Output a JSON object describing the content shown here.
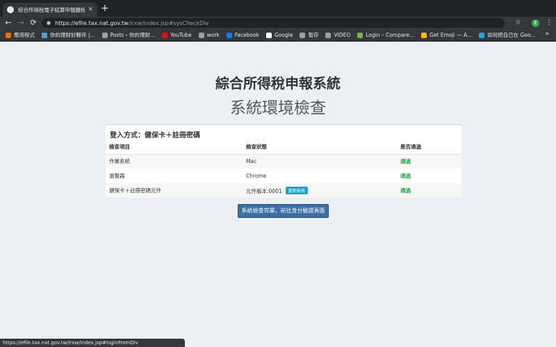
{
  "browser": {
    "tab": {
      "title": "綜合所得稅電子結算申報繳稅系統",
      "favicon": "globe-icon",
      "close_label": "✕"
    },
    "new_tab_label": "+",
    "nav": {
      "back": "←",
      "forward": "→",
      "reload": "⟳"
    },
    "lock": "🔒",
    "url_host": "https://efile.tax.nat.gov.tw",
    "url_path": "/irxw/index.jsp#sysCheckDiv",
    "star": "☆",
    "profile_initial": "E",
    "menu": "⋮",
    "bookmarks": [
      {
        "label": "應用程式",
        "icon": "apps-grid-icon",
        "color": "#e8710a"
      },
      {
        "label": "你的理財好夥伴 |...",
        "icon": "finance-icon",
        "color": "#4fa3d1"
      },
      {
        "label": "Posts ‹ 你的理財...",
        "icon": "page-icon",
        "color": "#9aa0a6"
      },
      {
        "label": "YouTube",
        "icon": "youtube-icon",
        "color": "#ff0000"
      },
      {
        "label": "work",
        "icon": "folder-icon",
        "color": "#9aa0a6"
      },
      {
        "label": "Facebook",
        "icon": "facebook-icon",
        "color": "#1877f2"
      },
      {
        "label": "Google",
        "icon": "google-icon",
        "color": "#ffffff"
      },
      {
        "label": "暫存",
        "icon": "folder-icon",
        "color": "#9aa0a6"
      },
      {
        "label": "VIDEO",
        "icon": "folder-icon",
        "color": "#9aa0a6"
      },
      {
        "label": "Login – Compare...",
        "icon": "login-icon",
        "color": "#7cb342"
      },
      {
        "label": "Get Emoji — A...",
        "icon": "emoji-icon",
        "color": "#fbbc04"
      },
      {
        "label": "如何把自己在 Goo...",
        "icon": "telegram-icon",
        "color": "#2aa3e6"
      }
    ],
    "bookmarks_more": "»"
  },
  "page": {
    "title": "綜合所得稅申報系統",
    "subtitle": "系統環境檢查"
  },
  "check": {
    "heading": "登入方式：健保卡＋註冊密碼",
    "columns": [
      "檢查項目",
      "檢查狀態",
      "是否通過"
    ],
    "rows": [
      {
        "item": "作業系統",
        "status": "Mac",
        "result": "通過"
      },
      {
        "item": "瀏覽器",
        "status": "Chrome",
        "result": "通過"
      },
      {
        "item": "健保卡＋註冊密碼元件",
        "status": "元件版本:0001",
        "recheck": "重新檢測",
        "result": "通過"
      }
    ]
  },
  "primary_button": "系統檢查完畢，前往身分驗證頁面",
  "status_url": "https://efile.tax.nat.gov.tw/irxw/index.jsp#loginFromDiv"
}
